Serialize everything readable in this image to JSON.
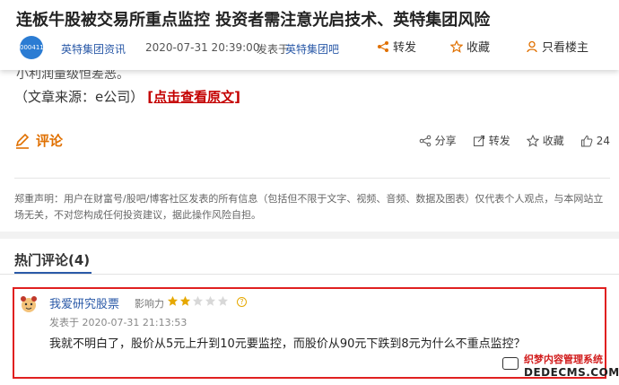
{
  "header": {
    "title": "连板牛股被交易所重点监控 投资者需注意光启技术、英特集团风险",
    "avatar_text": "000411",
    "author": "英特集团资讯",
    "date": "2020-07-31 20:39:00",
    "published_in_label": "发表于",
    "published_in": "英特集团吧",
    "share_label": "转发",
    "favorite_label": "收藏",
    "only_owner_label": "只看楼主"
  },
  "article": {
    "cut_text": "小利润量级恒差恶。",
    "source_prefix": "（文章来源：e公司）",
    "source_link": "[点击查看原文]"
  },
  "comment_bar": {
    "title": "评论",
    "share": "分享",
    "forward": "转发",
    "favorite": "收藏",
    "likes": "24"
  },
  "disclaimer": "郑重声明：用户在财富号/股吧/博客社区发表的所有信息（包括但不限于文字、视频、音频、数据及图表）仅代表个人观点，与本网站立场无关，不对您构成任何投资建议，据此操作风险自担。",
  "hot_comments": {
    "title": "热门评论(4)",
    "items": [
      {
        "user": "我爱研究股票",
        "influence_label": "影响力",
        "stars": 2,
        "max_stars": 5,
        "date": "发表于 2020-07-31 21:13:53",
        "text": "我就不明白了，股价从5元上升到10元要监控，而股价从90元下跌到8元为什么不重点监控？"
      }
    ]
  },
  "watermark": {
    "cn": "织梦内容管理系统",
    "en": "DEDECMS.COM"
  },
  "colors": {
    "link_blue": "#2b5aa8",
    "comment_orange": "#e07000",
    "highlight_red": "#e02020",
    "star_gold": "#e6a800"
  }
}
